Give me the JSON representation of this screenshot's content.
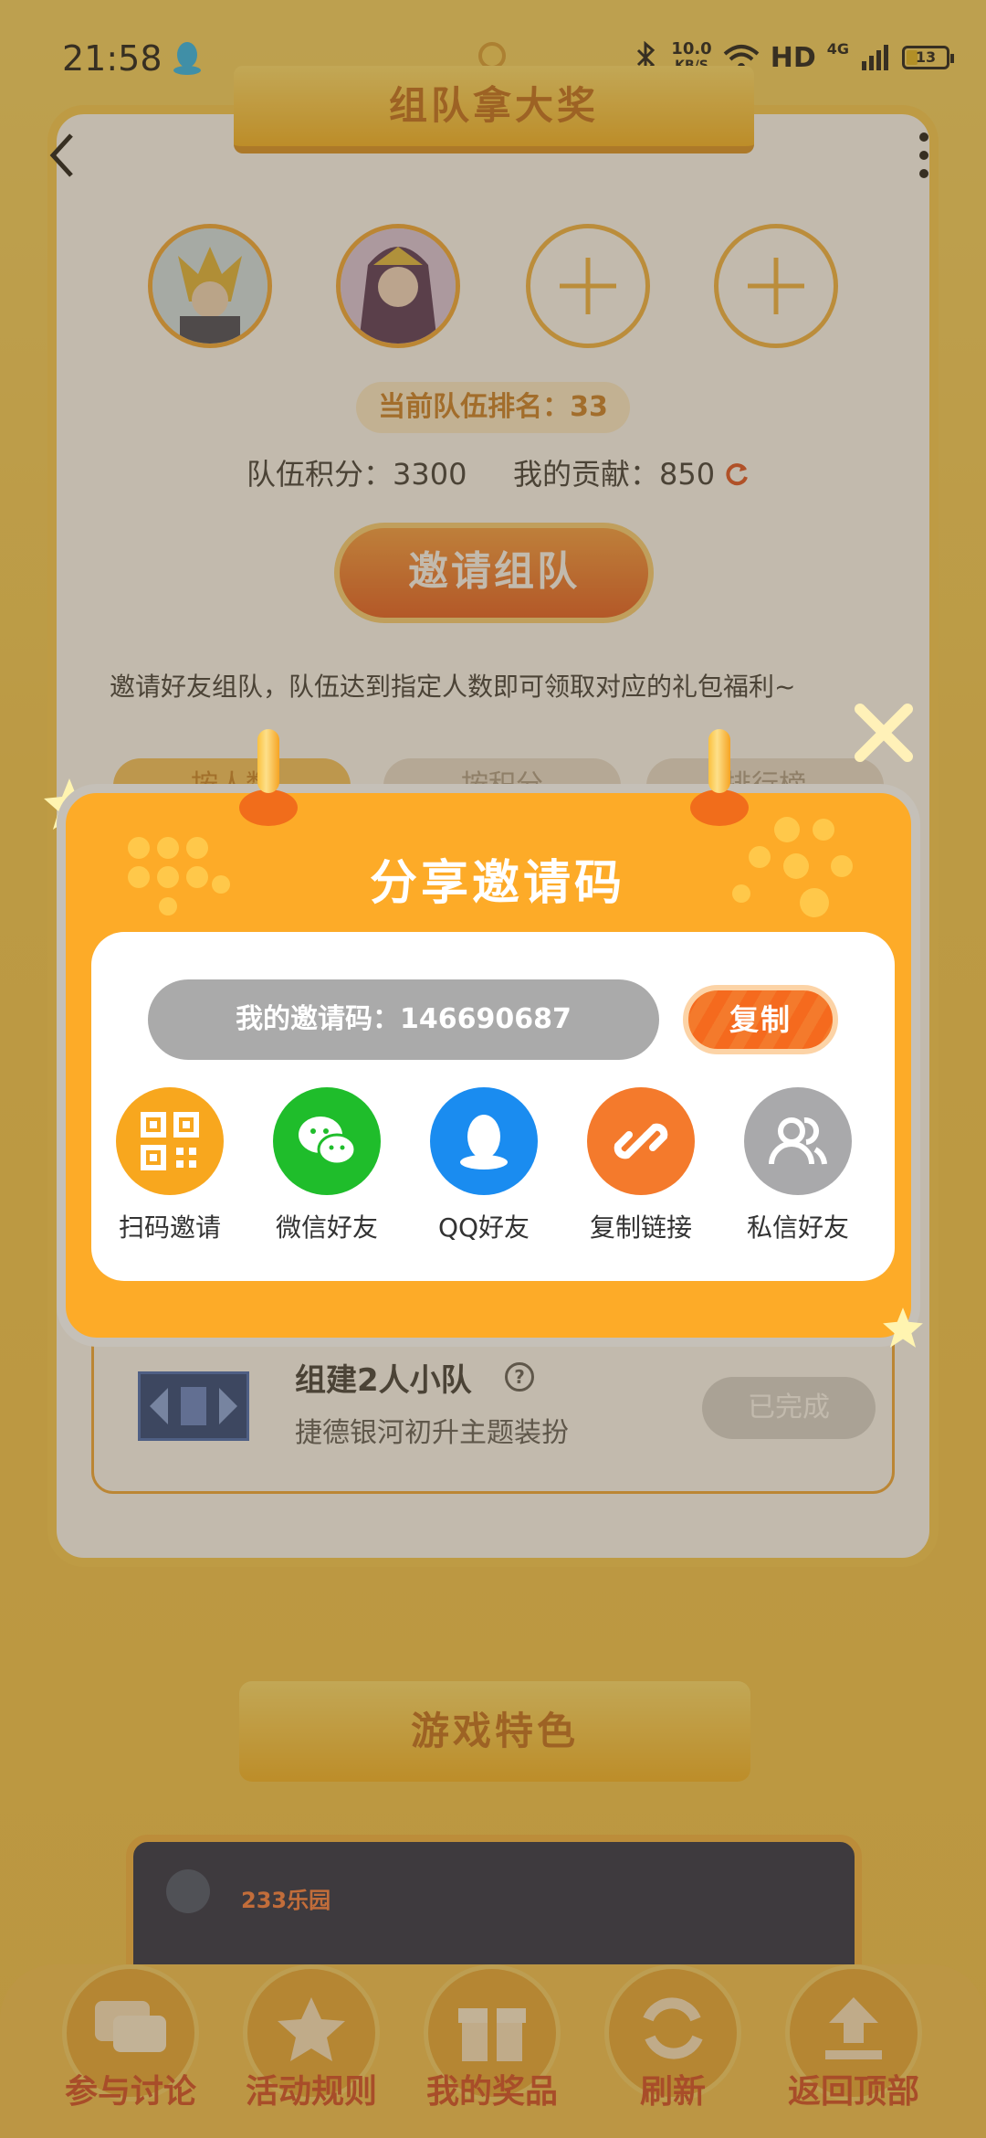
{
  "status_bar": {
    "time": "21:58",
    "net_speed_value": "10.0",
    "net_speed_unit": "KB/S",
    "network": "HD",
    "cell_type": "4G",
    "battery_level": "13"
  },
  "team": {
    "banner_title": "组队拿大奖",
    "rank_text": "当前队伍排名：33",
    "score_text": "队伍积分：3300",
    "contribution_text": "我的贡献：850",
    "invite_button": "邀请组队",
    "description": "邀请好友组队，队伍达到指定人数即可领取对应的礼包福利~",
    "tabs": [
      "按人数",
      "按积分",
      "排行榜"
    ]
  },
  "task": {
    "title": "组建2人小队",
    "reward": "捷德银河初升主题装扮",
    "status": "已完成"
  },
  "feature_banner": "游戏特色",
  "preview": {
    "logo_text": "233乐园"
  },
  "dialog": {
    "title": "分享邀请码",
    "invite_code_text": "我的邀请码：146690687",
    "copy_button": "复制",
    "options": [
      {
        "label": "扫码邀请",
        "icon": "qr-code-icon",
        "color": "#f8a71e"
      },
      {
        "label": "微信好友",
        "icon": "wechat-icon",
        "color": "#1fbd2b"
      },
      {
        "label": "QQ好友",
        "icon": "qq-icon",
        "color": "#1a8cf0"
      },
      {
        "label": "复制链接",
        "icon": "link-icon",
        "color": "#f47a2c"
      },
      {
        "label": "私信好友",
        "icon": "friends-icon",
        "color": "#a9a9ab"
      }
    ]
  },
  "bottom_nav": [
    {
      "label": "参与讨论",
      "icon": "chat-icon"
    },
    {
      "label": "活动规则",
      "icon": "rules-icon"
    },
    {
      "label": "我的奖品",
      "icon": "gift-icon"
    },
    {
      "label": "刷新",
      "icon": "refresh-icon"
    },
    {
      "label": "返回顶部",
      "icon": "back-to-top-icon"
    }
  ]
}
